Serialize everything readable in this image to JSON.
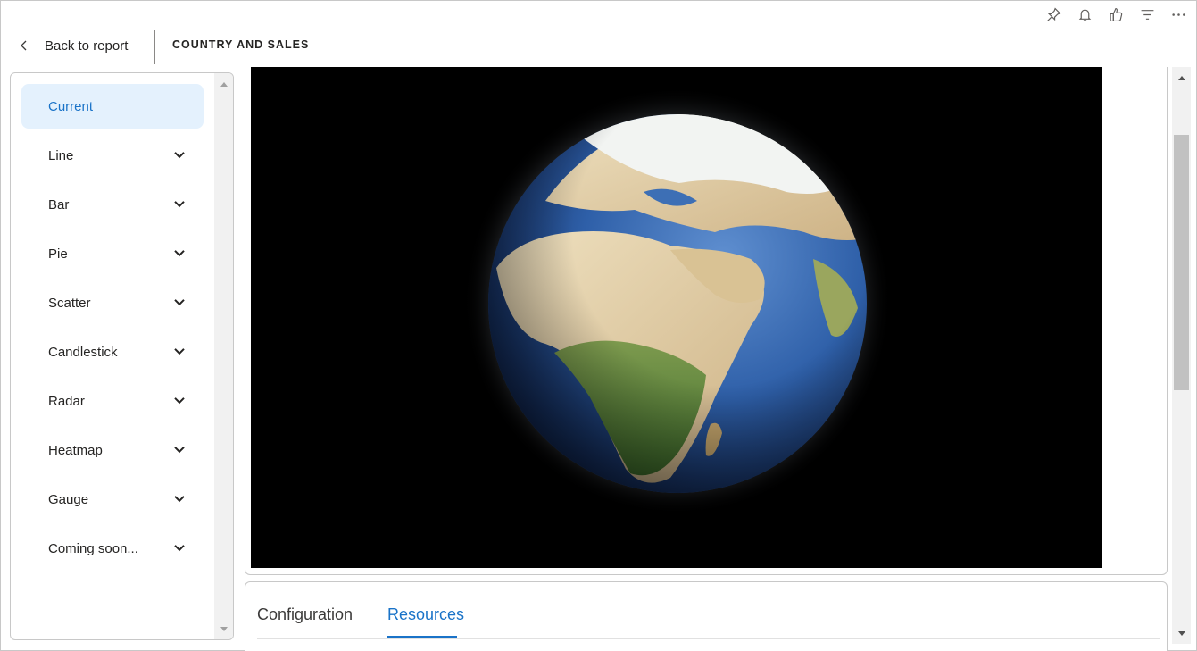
{
  "header": {
    "back_label": "Back to report",
    "title": "COUNTRY AND SALES"
  },
  "top_actions": [
    {
      "name": "pin-icon"
    },
    {
      "name": "bell-icon"
    },
    {
      "name": "thumbs-up-icon"
    },
    {
      "name": "filter-icon"
    },
    {
      "name": "more-icon"
    }
  ],
  "nav": {
    "items": [
      {
        "label": "Current",
        "active": true
      },
      {
        "label": "Line"
      },
      {
        "label": "Bar"
      },
      {
        "label": "Pie"
      },
      {
        "label": "Scatter"
      },
      {
        "label": "Candlestick"
      },
      {
        "label": "Radar"
      },
      {
        "label": "Heatmap"
      },
      {
        "label": "Gauge"
      },
      {
        "label": "Coming soon..."
      }
    ]
  },
  "tabs": {
    "configuration": "Configuration",
    "resources": "Resources",
    "active": "resources"
  },
  "colors": {
    "accent": "#1a73c8",
    "active_bg": "#e4f1fd"
  }
}
